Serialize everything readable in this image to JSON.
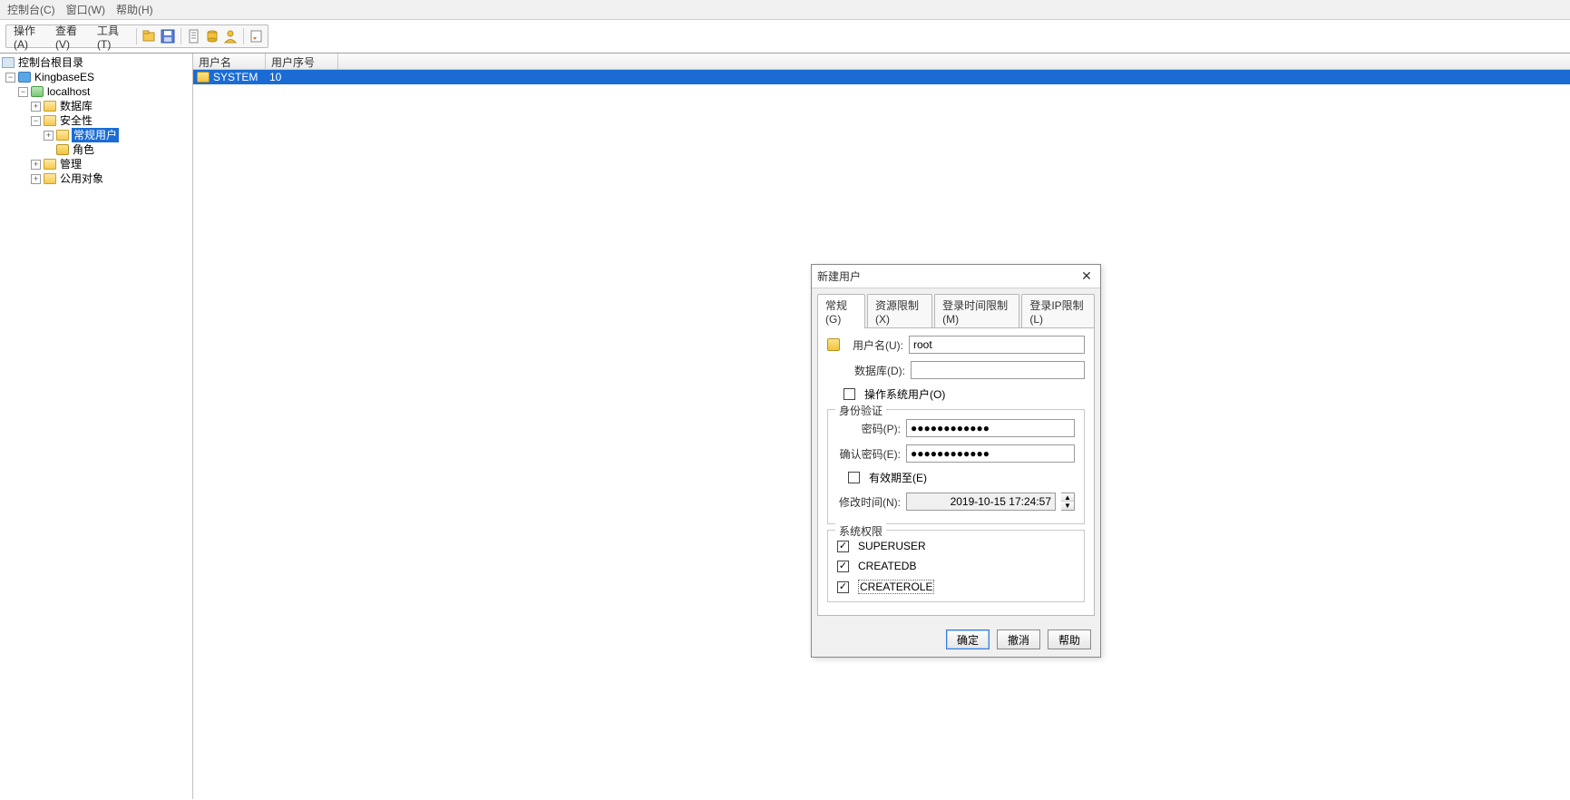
{
  "menubar": {
    "console": "控制台(C)",
    "window": "窗口(W)",
    "help": "帮助(H)"
  },
  "toolbar": {
    "action": "操作(A)",
    "view": "查看(V)",
    "tool": "工具(T)"
  },
  "tree": {
    "root": "控制台根目录",
    "kingbase": "KingbaseES",
    "localhost": "localhost",
    "database": "数据库",
    "security": "安全性",
    "regular_users": "常规用户",
    "roles": "角色",
    "management": "管理",
    "public_objects": "公用对象"
  },
  "table": {
    "col_username": "用户名",
    "col_userid": "用户序号",
    "row0": {
      "name": "SYSTEM",
      "id": "10"
    }
  },
  "dialog": {
    "title": "新建用户",
    "tabs": {
      "general": "常规(G)",
      "resource": "资源限制(X)",
      "login_time": "登录时间限制(M)",
      "login_ip": "登录IP限制(L)"
    },
    "labels": {
      "username": "用户名(U):",
      "database": "数据库(D):",
      "os_user": "操作系统用户(O)",
      "auth_group": "身份验证",
      "password": "密码(P):",
      "confirm_password": "确认密码(E):",
      "expire": "有效期至(E)",
      "modify_time": "修改时间(N):",
      "sys_priv_group": "系统权限",
      "superuser": "SUPERUSER",
      "createdb": "CREATEDB",
      "createrole": "CREATEROLE"
    },
    "values": {
      "username": "root",
      "database": "",
      "password": "●●●●●●●●●●●●",
      "confirm_password": "●●●●●●●●●●●●",
      "modify_time": "2019-10-15 17:24:57"
    },
    "checks": {
      "os_user": false,
      "expire": false,
      "superuser": true,
      "createdb": true,
      "createrole": true
    },
    "buttons": {
      "ok": "确定",
      "cancel": "撤消",
      "help": "帮助"
    }
  }
}
